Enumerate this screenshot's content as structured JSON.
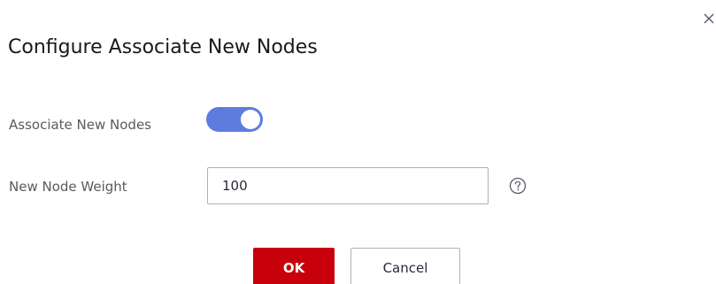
{
  "dialog": {
    "title": "Configure Associate New Nodes",
    "close_icon": "close-icon"
  },
  "form": {
    "associate_label": "Associate New Nodes",
    "associate_enabled": true,
    "weight_label": "New Node Weight",
    "weight_value": "100",
    "help_icon": "question-circle-icon"
  },
  "buttons": {
    "ok_label": "OK",
    "cancel_label": "Cancel"
  },
  "colors": {
    "toggle_on": "#5e7ce0",
    "primary_button": "#c7000b"
  }
}
